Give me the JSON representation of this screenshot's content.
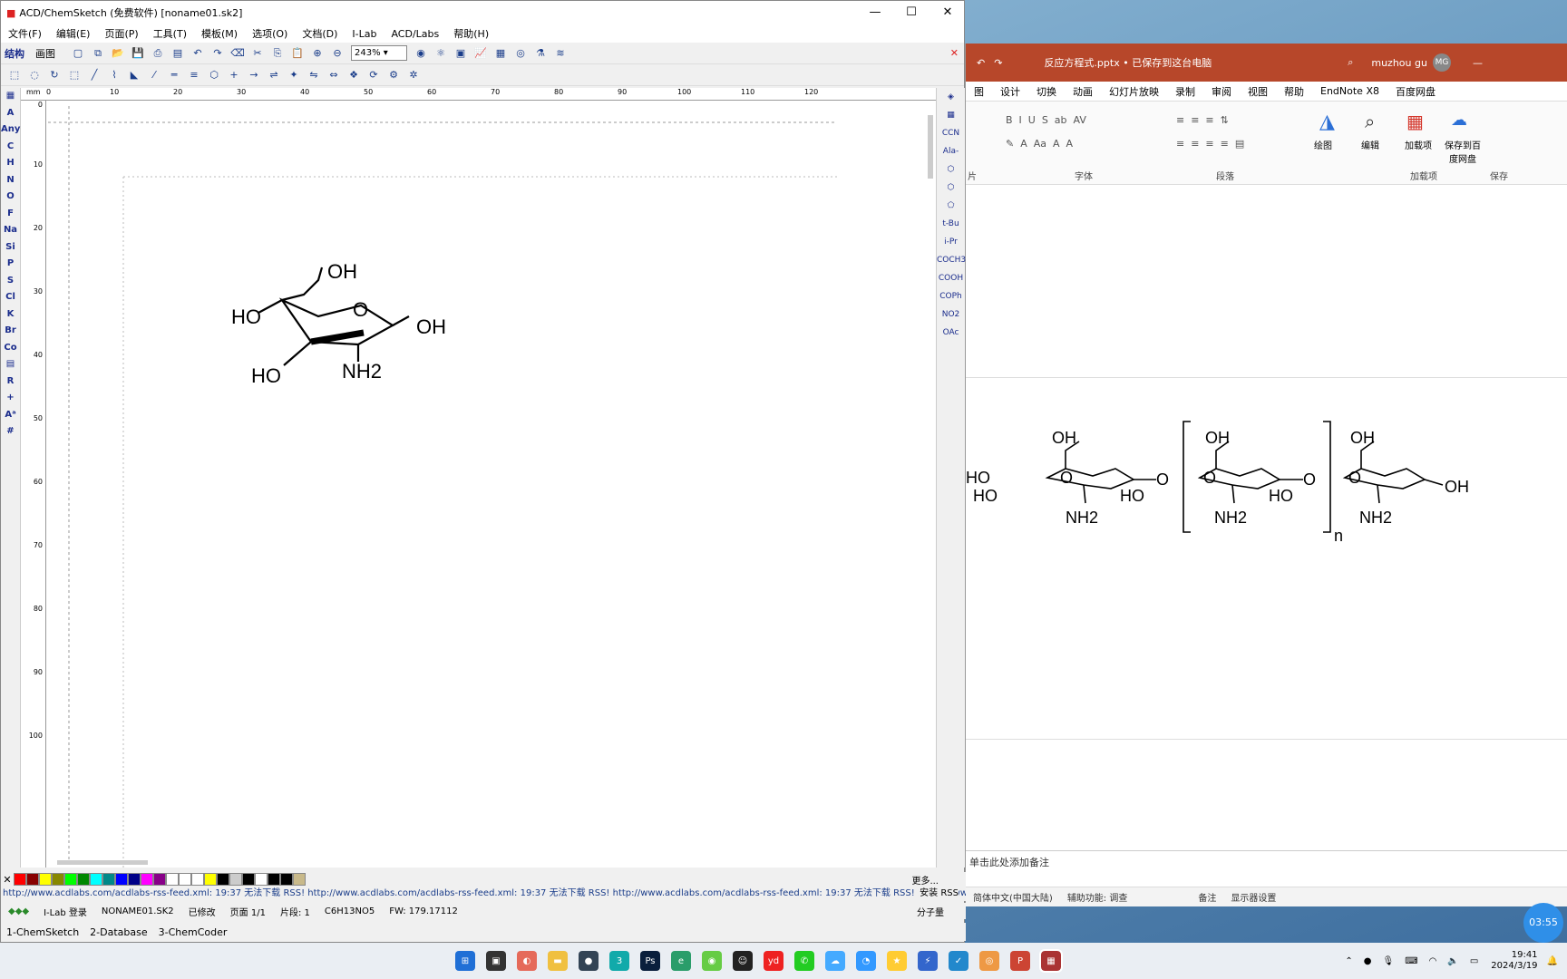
{
  "acd": {
    "title": "ACD/ChemSketch (免费软件) [noname01.sk2]",
    "menu": [
      "文件(F)",
      "编辑(E)",
      "页面(P)",
      "工具(T)",
      "模板(M)",
      "选项(O)",
      "文档(D)",
      "I-Lab",
      "ACD/Labs",
      "帮助(H)"
    ],
    "mode_tabs": [
      "结构",
      "画图"
    ],
    "zoom": "243%",
    "left_atoms": [
      "A",
      "Any",
      "C",
      "H",
      "N",
      "O",
      "F",
      "Na",
      "Si",
      "P",
      "S",
      "Cl",
      "K",
      "Br",
      "Co",
      "R",
      "+",
      "#"
    ],
    "right_groups": [
      "CCN",
      "Ala-",
      "t-Bu",
      "i-Pr",
      "COCH3",
      "COOH",
      "COPh",
      "NO2",
      "OAc"
    ],
    "ruler_unit": "mm",
    "ruler_h": [
      "0",
      "10",
      "20",
      "30",
      "40",
      "50",
      "60",
      "70",
      "80",
      "90",
      "100",
      "110",
      "120"
    ],
    "ruler_v": [
      "0",
      "10",
      "20",
      "30",
      "40",
      "50",
      "60",
      "70",
      "80",
      "90",
      "100"
    ],
    "molecule": {
      "oh_top": "OH",
      "ho_left": "HO",
      "o_ring": "O",
      "oh_right": "OH",
      "ho_bottom": "HO",
      "nh2": "NH2"
    },
    "more_label": "更多...",
    "status_url": "http://www.acdlabs.com/acdlabs-rss-feed.xml: 19:37 无法下载 RSS! http://www.acdlabs.com/acdlabs-rss-feed.xml: 19:37 无法下载 RSS! http://www.acdlabs.com/acdlabs-rss-feed.xml: 19:37 无法下载 RSS! http://www.a",
    "install_rss": "安装 RSS",
    "info": [
      "I-Lab 登录",
      "NONAME01.SK2",
      "已修改",
      "页面 1/1",
      "片段: 1",
      "C6H13NO5",
      "FW: 179.17112",
      "分子量"
    ],
    "bottom_tabs": [
      "1-ChemSketch",
      "2-Database",
      "3-ChemCoder"
    ]
  },
  "ppt": {
    "title": "反应方程式.pptx • 已保存到这台电脑",
    "user": "muzhou gu",
    "initials": "MG",
    "tabs": [
      "图",
      "设计",
      "切换",
      "动画",
      "幻灯片放映",
      "录制",
      "审阅",
      "视图",
      "帮助",
      "EndNote X8",
      "百度网盘"
    ],
    "ribbon_groups": [
      "片",
      "字体",
      "段落",
      "加载项",
      "保存"
    ],
    "ribbon_btns": [
      "绘图",
      "编辑",
      "加载项",
      "保存到百度网盘"
    ],
    "molecule": {
      "oh1": "OH",
      "oh2": "OH",
      "oh3": "OH",
      "ho1": "HO",
      "ho2": "HO",
      "ho3": "HO",
      "ho4": "HO",
      "o_ring1": "O",
      "o_ring2": "O",
      "o_ring3": "O",
      "o_link1": "O",
      "o_link2": "O",
      "oh_end": "OH",
      "nh2_1": "NH2",
      "nh2_2": "NH2",
      "nh2_3": "NH2",
      "n": "n"
    },
    "notes": "单击此处添加备注",
    "status": [
      "简体中文(中国大陆)",
      "辅助功能: 调查",
      "备注",
      "显示器设置"
    ]
  },
  "taskbar": {
    "time": "19:41",
    "date": "2024/3/19",
    "float_clock": "03:55"
  }
}
